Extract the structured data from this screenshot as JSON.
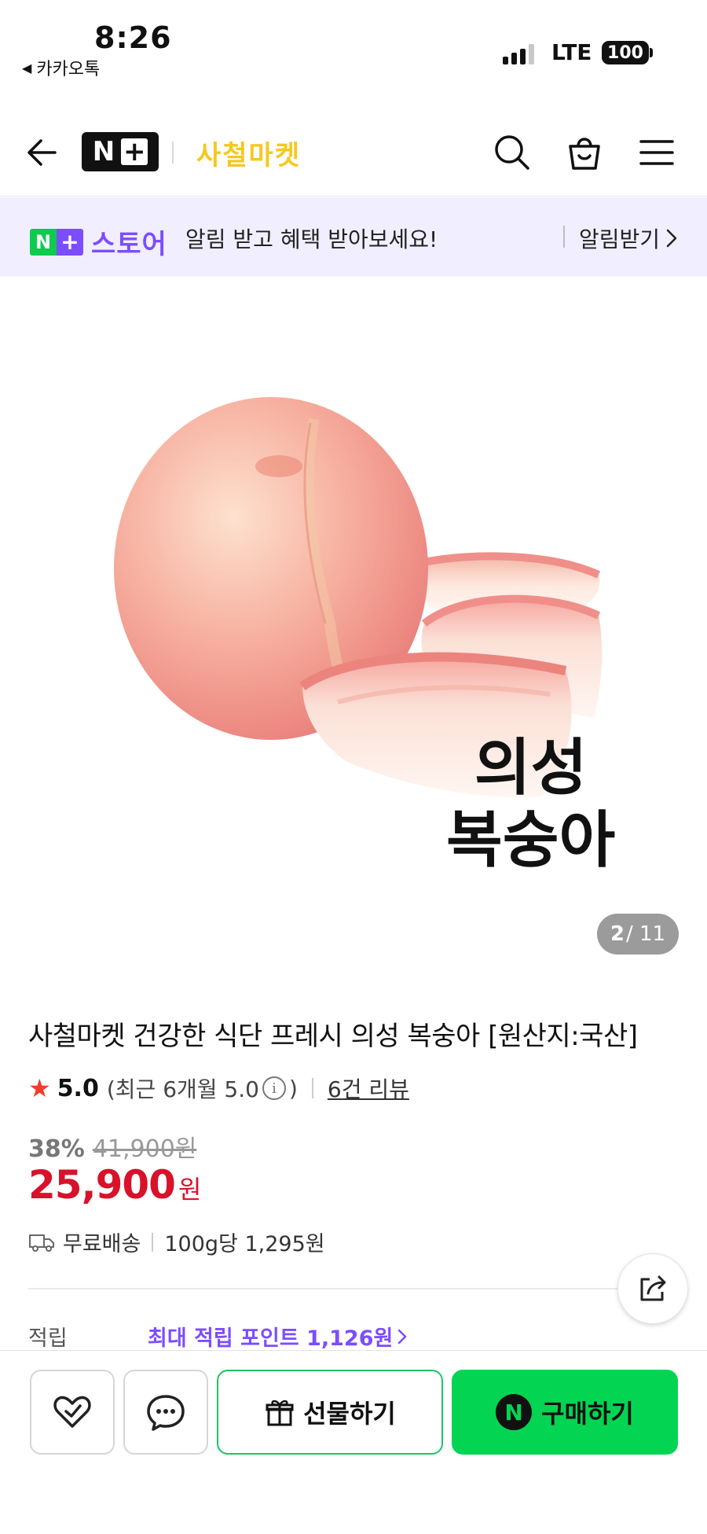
{
  "status_bar": {
    "time": "8:26",
    "back_app": "카카오톡",
    "network": "LTE",
    "battery": "100"
  },
  "header": {
    "logo_letter": "N",
    "logo_plus": "+",
    "store_name": "사철마켓"
  },
  "notice_banner": {
    "logo_n": "N",
    "logo_plus": "+",
    "logo_text": "스토어",
    "text": "알림 받고 혜택 받아보세요!",
    "cta": "알림받기",
    "colors": {
      "background": "#f1efff",
      "accent": "#7c4dff",
      "green": "#0ecb4e"
    }
  },
  "product_image": {
    "caption_line1": "의성",
    "caption_line2": "복숭아",
    "current": "2",
    "total": "/ 11"
  },
  "product": {
    "title": "사철마켓 건강한 식단 프레시 의성 복숭아 [원산지:국산]",
    "rating": "5.0",
    "recent_rating": "(최근 6개월 5.0",
    "recent_close": ")",
    "reviews": "6건 리뷰",
    "discount_rate": "38%",
    "original_price": "41,900원",
    "sale_price": "25,900",
    "price_unit": "원",
    "delivery": "무료배송",
    "unit_price": "100g당 1,295원",
    "points_label": "적립",
    "points_value": "최대 적립 포인트 1,126원",
    "colors": {
      "price": "#d8122a",
      "star": "#f03c2a",
      "points": "#7c4dff"
    }
  },
  "bottom_bar": {
    "gift_label": "선물하기",
    "buy_label": "구매하기",
    "buy_badge": "N",
    "colors": {
      "buy": "#03d553",
      "gift_border": "#1ec463"
    }
  }
}
